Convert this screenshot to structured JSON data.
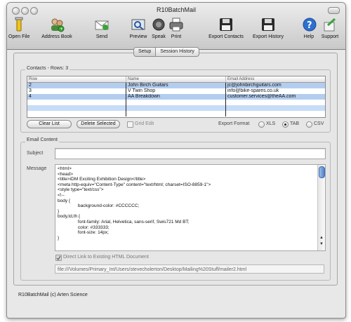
{
  "window": {
    "title": "R10BatchMail"
  },
  "toolbar": {
    "open_file": "Open File",
    "address_book": "Address Book",
    "send": "Send",
    "preview": "Preview",
    "speak": "Speak",
    "print": "Print",
    "export_contacts": "Export Contacts",
    "export_history": "Export History",
    "help": "Help",
    "support": "Support"
  },
  "tabs": [
    "Setup",
    "Session History"
  ],
  "contacts": {
    "group_label": "Contacts - Rows: 3",
    "columns": [
      "Row",
      "Name",
      "Email Address"
    ],
    "rows": [
      {
        "row": "2",
        "name": "John Birch Guitars",
        "email": "jc@johnbirchguitars.com"
      },
      {
        "row": "3",
        "name": "V Twin Shop",
        "email": "info@bike-spares.co.uk"
      },
      {
        "row": "4",
        "name": "AA Breakdown",
        "email": "customer.services@theAA.com"
      }
    ],
    "clear_list": "Clear List",
    "delete_selected": "Delete Selected",
    "grid_edit": "Grid Edit",
    "export_format_label": "Export Format",
    "formats": [
      "XLS",
      "TAB",
      "CSV"
    ],
    "selected_format": "TAB"
  },
  "email": {
    "group_label": "Email Content",
    "subject_label": "Subject",
    "subject_value": "",
    "message_label": "Message",
    "message_body": "<html>\n<head>\n<title>iDM Exciting Exhibition Design</title>\n<meta http-equiv=\"Content-Type\" content=\"text/html; charset=ISO-8859-1\">\n<style type=\"text/css\">\n<!--\nbody {\n                background-color: #CCCCCC;\n}\nbody,td,th {\n                font-family: Arial, Helvetica, sans-serif, Swis721 Md BT;\n                color: #333333;\n                font-size: 14px;\n}",
    "direct_link_label": "Direct Link to Existing HTML Document",
    "html_path": "file:///Volumes/Primary_Int/Users/stevecholerton/Desktop/Mailing%20Stuff/mailer2.html"
  },
  "footer": {
    "text": "R10BatchMail (c) Arten Science"
  }
}
